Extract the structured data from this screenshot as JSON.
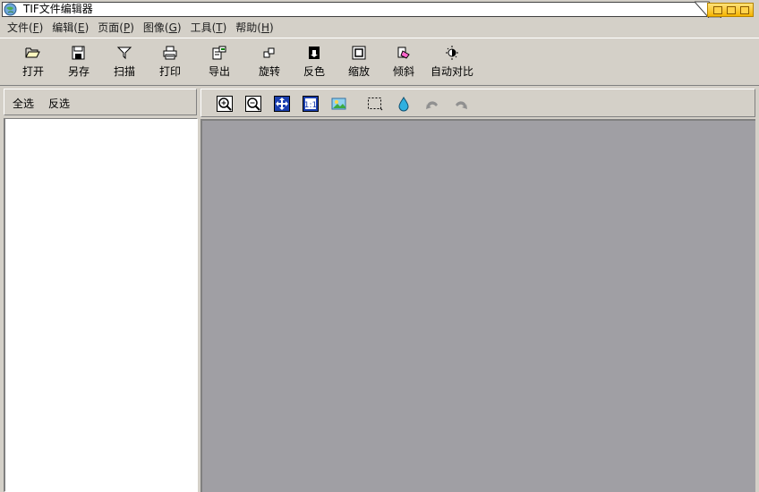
{
  "window": {
    "title": "TIF文件编辑器",
    "accent_color": "#f5b400"
  },
  "menu": [
    {
      "label": "文件(",
      "accel": "F",
      "suffix": ")"
    },
    {
      "label": "编辑(",
      "accel": "E",
      "suffix": ")"
    },
    {
      "label": "页面(",
      "accel": "P",
      "suffix": ")"
    },
    {
      "label": "图像(",
      "accel": "G",
      "suffix": ")"
    },
    {
      "label": "工具(",
      "accel": "T",
      "suffix": ")"
    },
    {
      "label": "帮助(",
      "accel": "H",
      "suffix": ")"
    }
  ],
  "toolbar": {
    "open": {
      "label": "打开",
      "icon": "folder-open-icon"
    },
    "save_as": {
      "label": "另存",
      "icon": "floppy-disk-icon"
    },
    "scan": {
      "label": "扫描",
      "icon": "funnel-scan-icon"
    },
    "print": {
      "label": "打印",
      "icon": "printer-icon"
    },
    "export": {
      "label": "导出",
      "icon": "export-document-icon"
    },
    "rotate": {
      "label": "旋转",
      "icon": "rotate-icon"
    },
    "invert": {
      "label": "反色",
      "icon": "invert-color-icon"
    },
    "zoom": {
      "label": "缩放",
      "icon": "resize-frame-icon"
    },
    "deskew": {
      "label": "倾斜",
      "icon": "deskew-icon"
    },
    "auto_contrast": {
      "label": "自动对比",
      "icon": "brightness-icon"
    }
  },
  "left_panel": {
    "select_all": "全选",
    "invert_selection": "反选"
  },
  "image_toolbar": {
    "icons": [
      "zoom-in-icon",
      "zoom-out-icon",
      "fit-window-icon",
      "actual-size-icon",
      "image-icon",
      "select-rect-icon",
      "fill-drop-icon",
      "undo-icon",
      "redo-icon"
    ]
  },
  "canvas_color": "#a09fa4"
}
